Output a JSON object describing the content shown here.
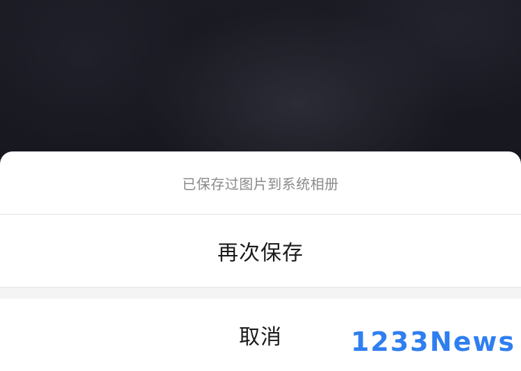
{
  "action_sheet": {
    "title": "已保存过图片到系统相册",
    "save_again_label": "再次保存",
    "cancel_label": "取消"
  },
  "watermark": {
    "text": "1233News"
  },
  "colors": {
    "backdrop": "#16161d",
    "sheet": "#ffffff",
    "title_text": "#8a8a8a",
    "action_text": "#1a1a1a",
    "watermark": "#2f7ff0"
  }
}
